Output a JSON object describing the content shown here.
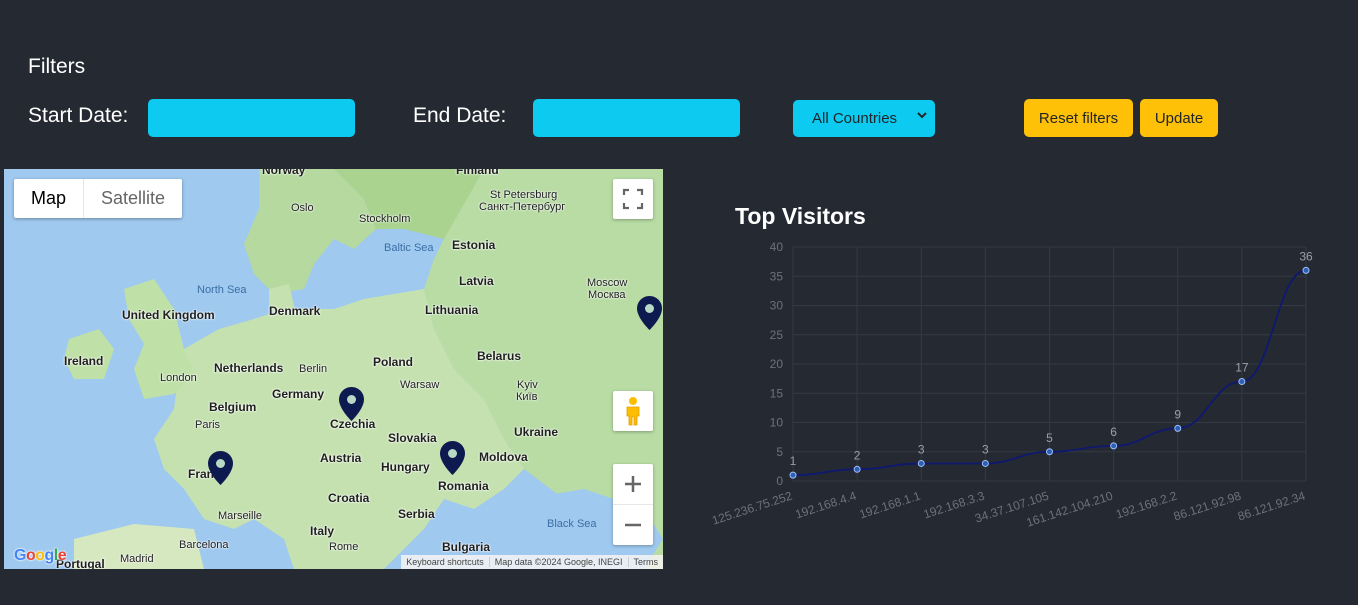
{
  "filters": {
    "title": "Filters",
    "start_date_label": "Start Date:",
    "start_date_value": "",
    "end_date_label": "End Date:",
    "end_date_value": "",
    "country_select_value": "All Countries",
    "reset_label": "Reset filters",
    "update_label": "Update"
  },
  "colors": {
    "page_bg": "#252a32",
    "input_accent": "#0dcaf0",
    "button_accent": "#ffc107",
    "map_pin": "#0d1a4f",
    "chart_line": "#10196b"
  },
  "map": {
    "type_control": {
      "map_label": "Map",
      "satellite_label": "Satellite"
    },
    "icons": [
      "fullscreen-icon",
      "pegman-icon",
      "zoom-in-icon",
      "zoom-out-icon",
      "map-pin-icon"
    ],
    "places": [
      {
        "name": "Norway",
        "kind": "country"
      },
      {
        "name": "Finland",
        "kind": "country"
      },
      {
        "name": "Oslo",
        "kind": "city"
      },
      {
        "name": "Stockholm",
        "kind": "city"
      },
      {
        "name": "St Petersburg",
        "kind": "city"
      },
      {
        "name": "Санкт-Петербург",
        "kind": "city"
      },
      {
        "name": "Baltic Sea",
        "kind": "sea"
      },
      {
        "name": "Estonia",
        "kind": "country"
      },
      {
        "name": "North Sea",
        "kind": "sea"
      },
      {
        "name": "Moscow",
        "kind": "city"
      },
      {
        "name": "Москва",
        "kind": "city"
      },
      {
        "name": "Latvia",
        "kind": "country"
      },
      {
        "name": "Denmark",
        "kind": "country"
      },
      {
        "name": "Lithuania",
        "kind": "country"
      },
      {
        "name": "United Kingdom",
        "kind": "country"
      },
      {
        "name": "Ireland",
        "kind": "country"
      },
      {
        "name": "Belarus",
        "kind": "country"
      },
      {
        "name": "Netherlands",
        "kind": "country"
      },
      {
        "name": "Berlin",
        "kind": "city"
      },
      {
        "name": "Poland",
        "kind": "country"
      },
      {
        "name": "London",
        "kind": "city"
      },
      {
        "name": "Germany",
        "kind": "country"
      },
      {
        "name": "Warsaw",
        "kind": "city"
      },
      {
        "name": "Kyiv",
        "kind": "city"
      },
      {
        "name": "Київ",
        "kind": "city"
      },
      {
        "name": "Belgium",
        "kind": "country"
      },
      {
        "name": "Paris",
        "kind": "city"
      },
      {
        "name": "Czechia",
        "kind": "country"
      },
      {
        "name": "Ukraine",
        "kind": "country"
      },
      {
        "name": "Slovakia",
        "kind": "country"
      },
      {
        "name": "Austria",
        "kind": "country"
      },
      {
        "name": "Moldova",
        "kind": "country"
      },
      {
        "name": "France",
        "kind": "country"
      },
      {
        "name": "Hungary",
        "kind": "country"
      },
      {
        "name": "Romania",
        "kind": "country"
      },
      {
        "name": "Croatia",
        "kind": "country"
      },
      {
        "name": "Marseille",
        "kind": "city"
      },
      {
        "name": "Serbia",
        "kind": "country"
      },
      {
        "name": "Italy",
        "kind": "country"
      },
      {
        "name": "Black Sea",
        "kind": "sea"
      },
      {
        "name": "Barcelona",
        "kind": "city"
      },
      {
        "name": "Rome",
        "kind": "city"
      },
      {
        "name": "Bulgaria",
        "kind": "country"
      },
      {
        "name": "Madrid",
        "kind": "city"
      },
      {
        "name": "Portugal",
        "kind": "country"
      }
    ],
    "attribution": {
      "shortcuts": "Keyboard shortcuts",
      "data": "Map data ©2024 Google, INEGI",
      "terms": "Terms"
    },
    "logo_text": "Google"
  },
  "chart_title": "Top Visitors",
  "chart_data": {
    "type": "line",
    "title": "Top Visitors",
    "categories": [
      "125.236.75.252",
      "192.168.4.4",
      "192.168.1.1",
      "192.168.3.3",
      "34.37.107.105",
      "161.142.104.210",
      "192.168.2.2",
      "86.121.92.98",
      "86.121.92.34"
    ],
    "values": [
      1,
      2,
      3,
      3,
      5,
      6,
      9,
      17,
      36
    ],
    "ylim": [
      0,
      40
    ],
    "yticks": [
      0,
      5,
      10,
      15,
      20,
      25,
      30,
      35,
      40
    ],
    "grid": true,
    "data_labels": true,
    "line_color": "#10196b"
  }
}
